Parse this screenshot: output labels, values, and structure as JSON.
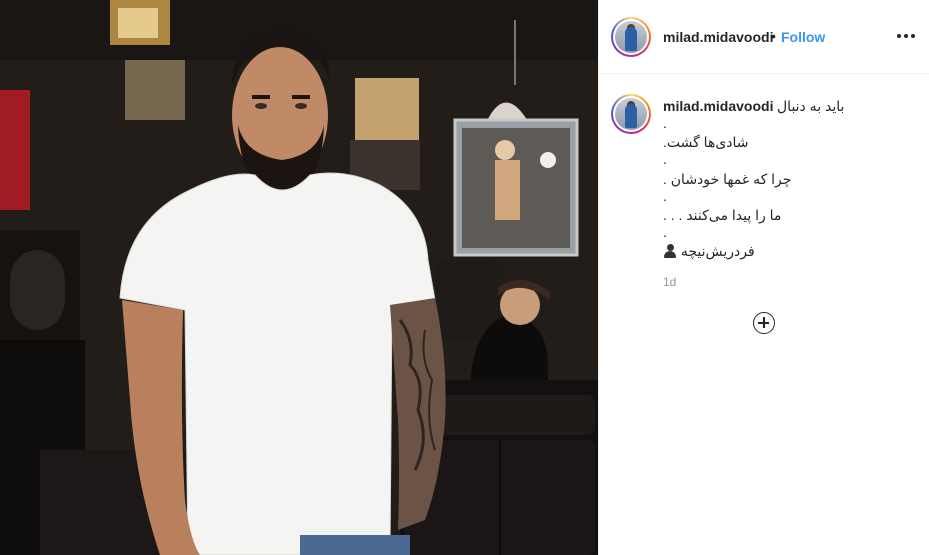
{
  "header": {
    "username": "milad.midavoodi",
    "separator": "•",
    "follow_label": "Follow",
    "more_icon": "more-horizontal-icon"
  },
  "caption": {
    "username": "milad.midavoodi",
    "line1": "باید به دنبال",
    "dot1": ".",
    "line2": "شادی‌ها گشت.",
    "dot2": ".",
    "line3": "چرا که غمها خودشان .",
    "dot3": ".",
    "line4": "ما را پیدا می‌کنند . . .",
    "dot4": ".",
    "line5": "فردریش‌نیچه",
    "signature_icon": "bust-silhouette-icon",
    "time": "1d"
  },
  "actions": {
    "load_more_icon": "plus-circle-icon"
  },
  "colors": {
    "accent": "#3897f0",
    "text": "#262626",
    "muted": "#999999",
    "border": "#efefef"
  }
}
